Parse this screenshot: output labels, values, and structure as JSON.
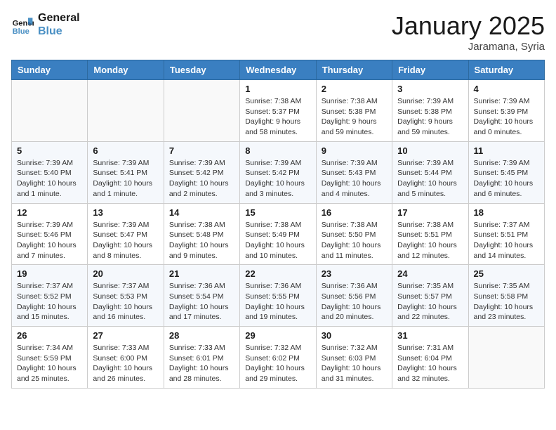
{
  "header": {
    "logo_line1": "General",
    "logo_line2": "Blue",
    "month": "January 2025",
    "location": "Jaramana, Syria"
  },
  "weekdays": [
    "Sunday",
    "Monday",
    "Tuesday",
    "Wednesday",
    "Thursday",
    "Friday",
    "Saturday"
  ],
  "weeks": [
    [
      {
        "day": "",
        "info": ""
      },
      {
        "day": "",
        "info": ""
      },
      {
        "day": "",
        "info": ""
      },
      {
        "day": "1",
        "info": "Sunrise: 7:38 AM\nSunset: 5:37 PM\nDaylight: 9 hours and 58 minutes."
      },
      {
        "day": "2",
        "info": "Sunrise: 7:38 AM\nSunset: 5:38 PM\nDaylight: 9 hours and 59 minutes."
      },
      {
        "day": "3",
        "info": "Sunrise: 7:39 AM\nSunset: 5:38 PM\nDaylight: 9 hours and 59 minutes."
      },
      {
        "day": "4",
        "info": "Sunrise: 7:39 AM\nSunset: 5:39 PM\nDaylight: 10 hours and 0 minutes."
      }
    ],
    [
      {
        "day": "5",
        "info": "Sunrise: 7:39 AM\nSunset: 5:40 PM\nDaylight: 10 hours and 1 minute."
      },
      {
        "day": "6",
        "info": "Sunrise: 7:39 AM\nSunset: 5:41 PM\nDaylight: 10 hours and 1 minute."
      },
      {
        "day": "7",
        "info": "Sunrise: 7:39 AM\nSunset: 5:42 PM\nDaylight: 10 hours and 2 minutes."
      },
      {
        "day": "8",
        "info": "Sunrise: 7:39 AM\nSunset: 5:42 PM\nDaylight: 10 hours and 3 minutes."
      },
      {
        "day": "9",
        "info": "Sunrise: 7:39 AM\nSunset: 5:43 PM\nDaylight: 10 hours and 4 minutes."
      },
      {
        "day": "10",
        "info": "Sunrise: 7:39 AM\nSunset: 5:44 PM\nDaylight: 10 hours and 5 minutes."
      },
      {
        "day": "11",
        "info": "Sunrise: 7:39 AM\nSunset: 5:45 PM\nDaylight: 10 hours and 6 minutes."
      }
    ],
    [
      {
        "day": "12",
        "info": "Sunrise: 7:39 AM\nSunset: 5:46 PM\nDaylight: 10 hours and 7 minutes."
      },
      {
        "day": "13",
        "info": "Sunrise: 7:39 AM\nSunset: 5:47 PM\nDaylight: 10 hours and 8 minutes."
      },
      {
        "day": "14",
        "info": "Sunrise: 7:38 AM\nSunset: 5:48 PM\nDaylight: 10 hours and 9 minutes."
      },
      {
        "day": "15",
        "info": "Sunrise: 7:38 AM\nSunset: 5:49 PM\nDaylight: 10 hours and 10 minutes."
      },
      {
        "day": "16",
        "info": "Sunrise: 7:38 AM\nSunset: 5:50 PM\nDaylight: 10 hours and 11 minutes."
      },
      {
        "day": "17",
        "info": "Sunrise: 7:38 AM\nSunset: 5:51 PM\nDaylight: 10 hours and 12 minutes."
      },
      {
        "day": "18",
        "info": "Sunrise: 7:37 AM\nSunset: 5:51 PM\nDaylight: 10 hours and 14 minutes."
      }
    ],
    [
      {
        "day": "19",
        "info": "Sunrise: 7:37 AM\nSunset: 5:52 PM\nDaylight: 10 hours and 15 minutes."
      },
      {
        "day": "20",
        "info": "Sunrise: 7:37 AM\nSunset: 5:53 PM\nDaylight: 10 hours and 16 minutes."
      },
      {
        "day": "21",
        "info": "Sunrise: 7:36 AM\nSunset: 5:54 PM\nDaylight: 10 hours and 17 minutes."
      },
      {
        "day": "22",
        "info": "Sunrise: 7:36 AM\nSunset: 5:55 PM\nDaylight: 10 hours and 19 minutes."
      },
      {
        "day": "23",
        "info": "Sunrise: 7:36 AM\nSunset: 5:56 PM\nDaylight: 10 hours and 20 minutes."
      },
      {
        "day": "24",
        "info": "Sunrise: 7:35 AM\nSunset: 5:57 PM\nDaylight: 10 hours and 22 minutes."
      },
      {
        "day": "25",
        "info": "Sunrise: 7:35 AM\nSunset: 5:58 PM\nDaylight: 10 hours and 23 minutes."
      }
    ],
    [
      {
        "day": "26",
        "info": "Sunrise: 7:34 AM\nSunset: 5:59 PM\nDaylight: 10 hours and 25 minutes."
      },
      {
        "day": "27",
        "info": "Sunrise: 7:33 AM\nSunset: 6:00 PM\nDaylight: 10 hours and 26 minutes."
      },
      {
        "day": "28",
        "info": "Sunrise: 7:33 AM\nSunset: 6:01 PM\nDaylight: 10 hours and 28 minutes."
      },
      {
        "day": "29",
        "info": "Sunrise: 7:32 AM\nSunset: 6:02 PM\nDaylight: 10 hours and 29 minutes."
      },
      {
        "day": "30",
        "info": "Sunrise: 7:32 AM\nSunset: 6:03 PM\nDaylight: 10 hours and 31 minutes."
      },
      {
        "day": "31",
        "info": "Sunrise: 7:31 AM\nSunset: 6:04 PM\nDaylight: 10 hours and 32 minutes."
      },
      {
        "day": "",
        "info": ""
      }
    ]
  ]
}
